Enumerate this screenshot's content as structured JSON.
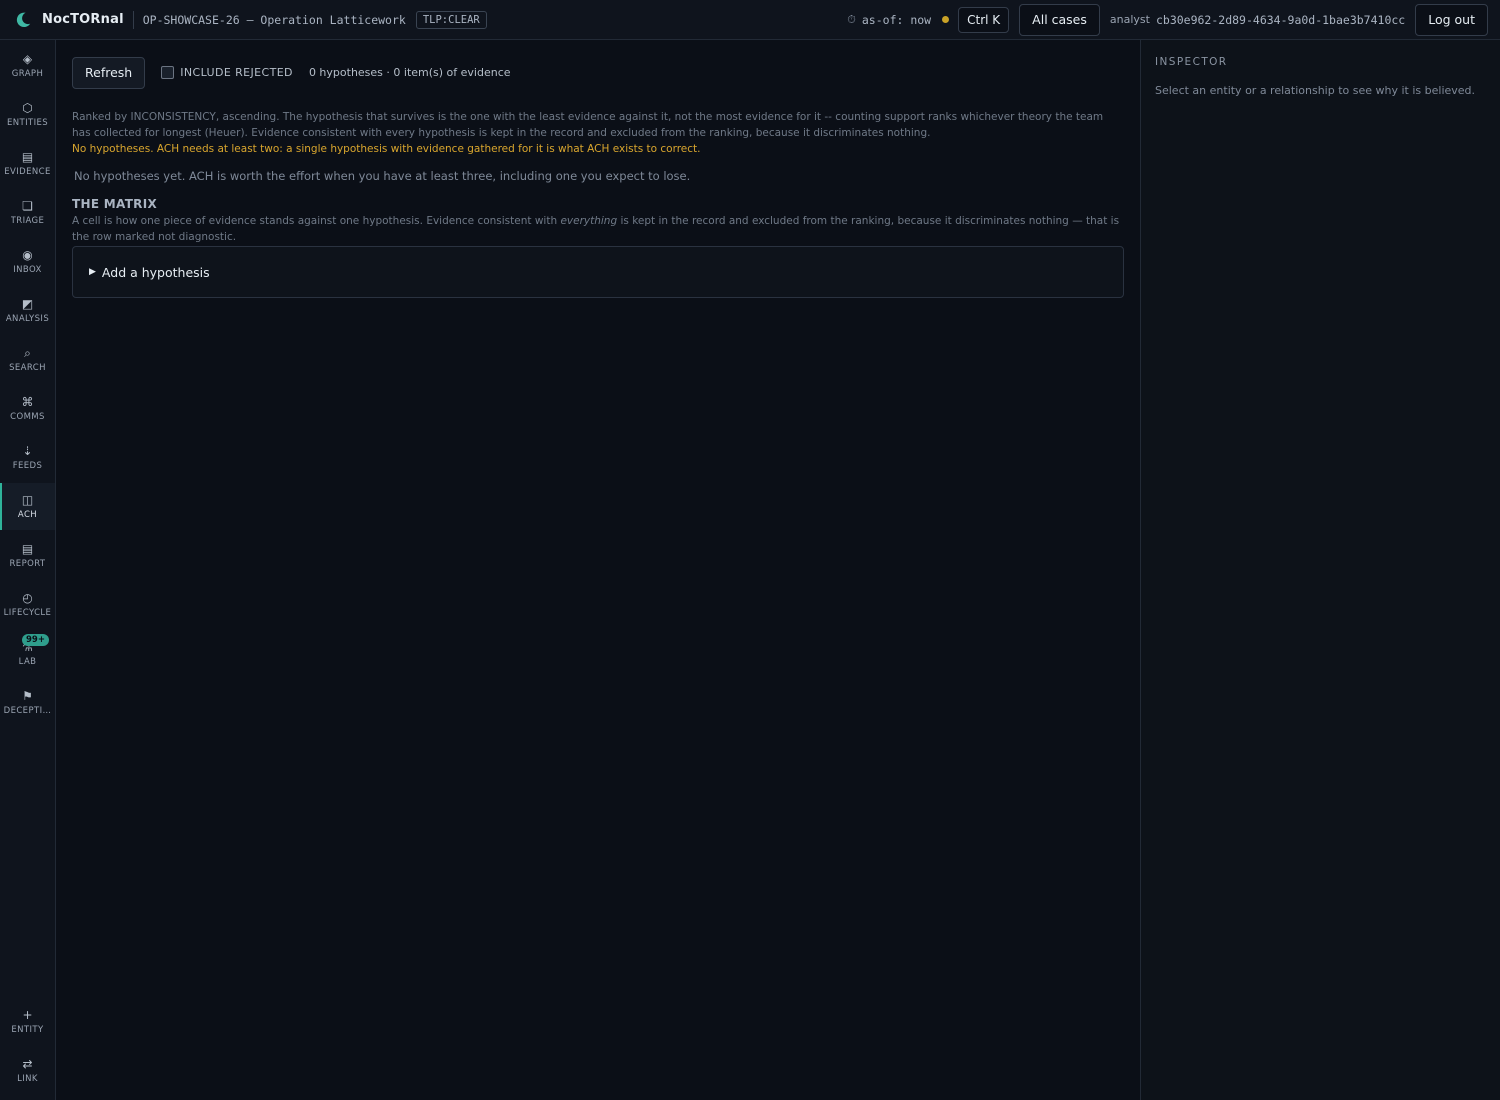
{
  "header": {
    "brand": "NocTORnal",
    "case_title": "OP-SHOWCASE-26 — Operation Latticework",
    "tlp": "TLP:CLEAR",
    "asof": "as-of: now",
    "shortcut": "Ctrl K",
    "all_cases": "All cases",
    "analyst_label": "analyst",
    "analyst_id": "cb30e962-2d89-4634-9a0d-1bae3b7410cc",
    "logout": "Log out",
    "status_color": "#c9a227"
  },
  "nav": {
    "items": [
      {
        "label": "GRAPH",
        "glyph": "◈",
        "icon": "graph-icon"
      },
      {
        "label": "ENTITIES",
        "glyph": "⬡",
        "icon": "hexagon-icon"
      },
      {
        "label": "EVIDENCE",
        "glyph": "▤",
        "icon": "document-icon"
      },
      {
        "label": "TRIAGE",
        "glyph": "❏",
        "icon": "triage-icon"
      },
      {
        "label": "INBOX",
        "glyph": "◉",
        "icon": "inbox-icon"
      },
      {
        "label": "ANALYSIS",
        "glyph": "◩",
        "icon": "analysis-icon"
      },
      {
        "label": "SEARCH",
        "glyph": "⌕",
        "icon": "search-icon"
      },
      {
        "label": "COMMS",
        "glyph": "⌘",
        "icon": "comms-icon"
      },
      {
        "label": "FEEDS",
        "glyph": "⇣",
        "icon": "feeds-icon"
      },
      {
        "label": "ACH",
        "glyph": "◫",
        "icon": "columns-icon",
        "active": true
      },
      {
        "label": "REPORT",
        "glyph": "▤",
        "icon": "report-icon"
      },
      {
        "label": "LIFECYCLE",
        "glyph": "◴",
        "icon": "lifecycle-icon"
      },
      {
        "label": "LAB",
        "glyph": "⚗",
        "icon": "lab-icon",
        "badge": "99+"
      },
      {
        "label": "DECEPTI…",
        "glyph": "⚑",
        "icon": "flag-icon"
      }
    ],
    "bottom_items": [
      {
        "label": "ENTITY",
        "glyph": "+",
        "icon": "plus-icon"
      },
      {
        "label": "LINK",
        "glyph": "⇄",
        "icon": "link-icon"
      }
    ],
    "accent_color": "#2fb39a"
  },
  "main": {
    "refresh": "Refresh",
    "include_rejected": "INCLUDE REJECTED",
    "counts": "0 hypotheses · 0 item(s) of evidence",
    "description": "Ranked by INCONSISTENCY, ascending. The hypothesis that survives is the one with the least evidence against it, not the most evidence for it -- counting support ranks whichever theory the team has collected for longest (Heuer). Evidence consistent with every hypothesis is kept in the record and excluded from the ranking, because it discriminates nothing.",
    "warning": "No hypotheses. ACH needs at least two: a single hypothesis with evidence gathered for it is what ACH exists to correct.",
    "empty": "No hypotheses yet. ACH is worth the effort when you have at least three, including one you expect to lose.",
    "matrix_title": "THE MATRIX",
    "matrix_desc_pre": "A cell is how one piece of evidence stands against one hypothesis. Evidence consistent with ",
    "matrix_desc_em": "everything",
    "matrix_desc_post": " is kept in the record and excluded from the ranking, because it discriminates nothing — that is the row marked not diagnostic.",
    "add_hypothesis": "Add a hypothesis",
    "warning_color": "#d9a62e"
  },
  "inspector": {
    "title": "INSPECTOR",
    "text": "Select an entity or a relationship to see why it is believed."
  }
}
